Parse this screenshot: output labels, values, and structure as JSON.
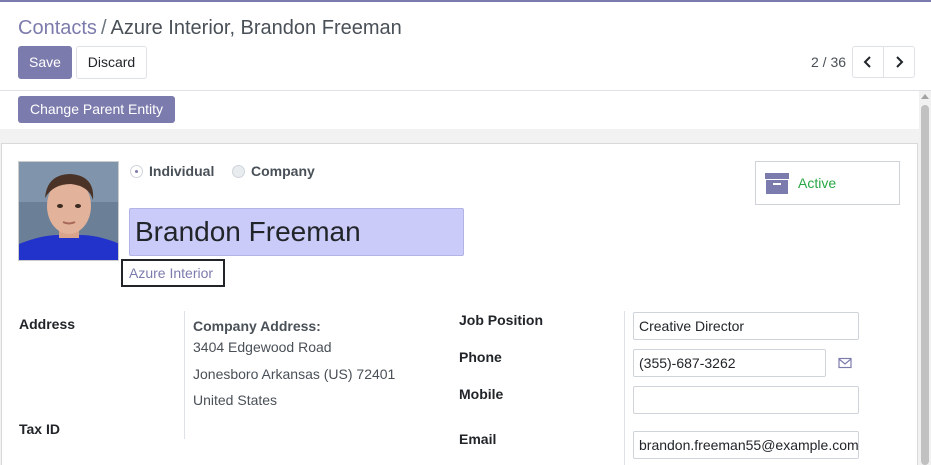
{
  "breadcrumb": {
    "parent": "Contacts",
    "separator": "/",
    "current": "Azure Interior, Brandon Freeman"
  },
  "toolbar": {
    "save_label": "Save",
    "discard_label": "Discard"
  },
  "pager": {
    "value": "2 / 36"
  },
  "statusbar": {
    "change_parent_label": "Change Parent Entity"
  },
  "form": {
    "company_type": {
      "options": [
        "Individual",
        "Company"
      ],
      "selected": "Individual"
    },
    "name": "Brandon Freeman",
    "parent_company": "Azure Interior",
    "smart_button": {
      "label": "Active",
      "icon": "archive-icon"
    },
    "address_label": "Address",
    "company_address_label": "Company Address:",
    "address_lines": [
      "3404 Edgewood Road",
      "Jonesboro Arkansas (US) 72401",
      "United States"
    ],
    "tax_id_label": "Tax ID",
    "job_position_label": "Job Position",
    "job_position": "Creative Director",
    "phone_label": "Phone",
    "phone": "(355)-687-3262",
    "mobile_label": "Mobile",
    "mobile": "",
    "email_label": "Email",
    "email": "brandon.freeman55@example.com"
  },
  "colors": {
    "accent": "#7c7bad",
    "name_bg": "#cbcbf9",
    "active": "#28a745"
  }
}
